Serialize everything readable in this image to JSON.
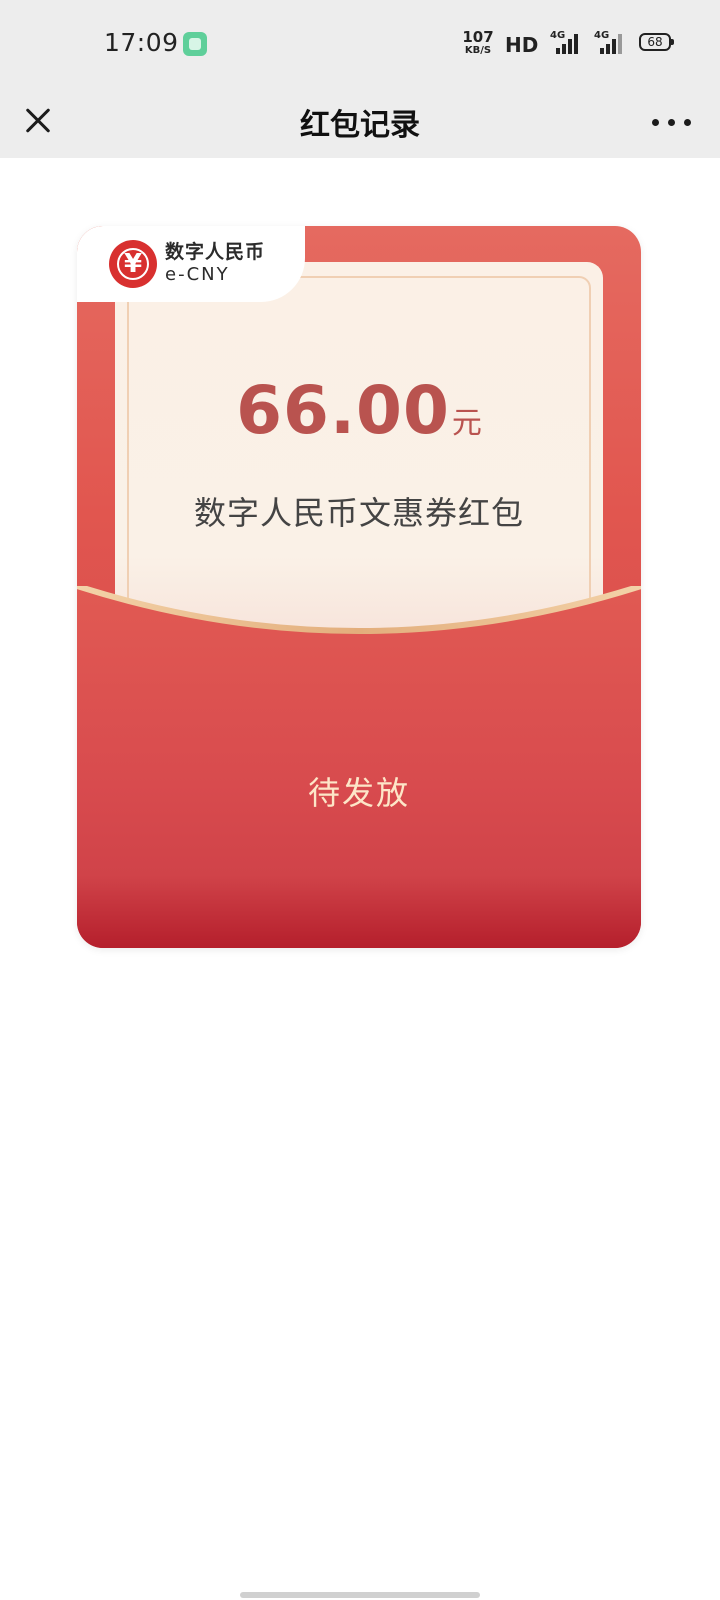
{
  "status_bar": {
    "time": "17:09",
    "net_speed_value": "107",
    "net_speed_unit": "KB/S",
    "hd_label": "HD",
    "signal_1_tag": "4G",
    "signal_2_tag": "4G",
    "battery_level": "68"
  },
  "nav": {
    "title": "红包记录",
    "close_icon": "close-icon",
    "more_icon": "more-dots-icon"
  },
  "card": {
    "brand_cn": "数字人民币",
    "brand_en": "e-CNY",
    "logo_glyph": "¥",
    "amount": "66.00",
    "unit": "元",
    "name": "数字人民币文惠券红包",
    "status": "待发放",
    "colors": {
      "primary_red": "#e1564f",
      "amount_color": "#b9534f",
      "gold_line": "#e8b987"
    }
  }
}
